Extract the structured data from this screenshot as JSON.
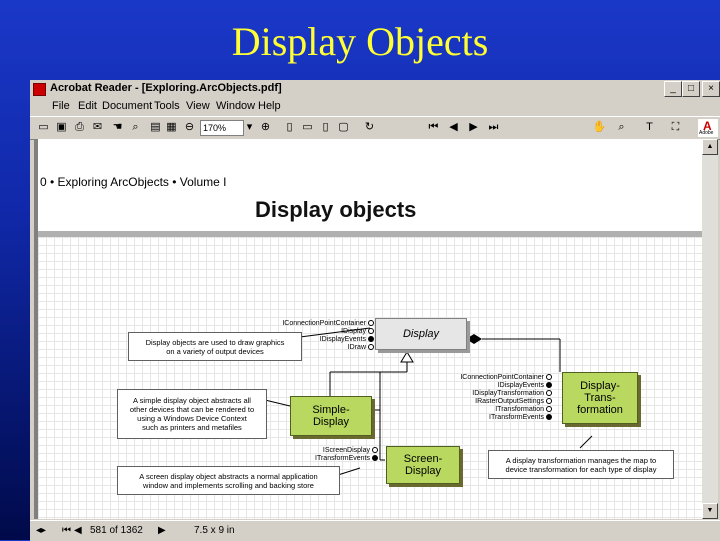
{
  "slide": {
    "title": "Display Objects"
  },
  "window": {
    "title": "Acrobat Reader - [Exploring.ArcObjects.pdf]",
    "controls": {
      "minimize": "_",
      "maximize": "□",
      "close": "×"
    },
    "menu": [
      "File",
      "Edit",
      "Document",
      "Tools",
      "View",
      "Window",
      "Help"
    ],
    "zoom": "170%",
    "adobe_logo": {
      "mark": "A",
      "text": "Adobe"
    }
  },
  "page": {
    "running_head": "0 • Exploring ArcObjects • Volume I"
  },
  "diagram": {
    "title": "Display objects",
    "classes": {
      "display": "Display",
      "simple": "Simple-\nDisplay",
      "screen": "Screen-\nDisplay",
      "transform": "Display-\nTrans-\nformation"
    },
    "interfaces_display": [
      "IConnectionPointContainer",
      "IDisplay",
      "IDisplayEvents",
      "IDraw"
    ],
    "interfaces_transform": [
      "IConnectionPointContainer",
      "IDisplayEvents",
      "IDisplayTransformation",
      "IRasterOutputSettings",
      "ITransformation",
      "ITransformEvents"
    ],
    "interfaces_screen": [
      "IScreenDisplay",
      "ITransformEvents"
    ],
    "notes": {
      "display": "Display objects are used to draw graphics\non a variety of output devices",
      "simple": "A simple display object abstracts all\nother devices that can be rendered to\nusing a Windows Device Context\nsuch as printers and metafiles",
      "screen": "A screen display object abstracts a normal application\nwindow and implements scrolling and backing store",
      "transform": "A display transformation manages the map to\ndevice transformation for each type of display"
    }
  },
  "status": {
    "page_counter": "581 of 1362",
    "page_size": "7.5 x 9 in"
  }
}
